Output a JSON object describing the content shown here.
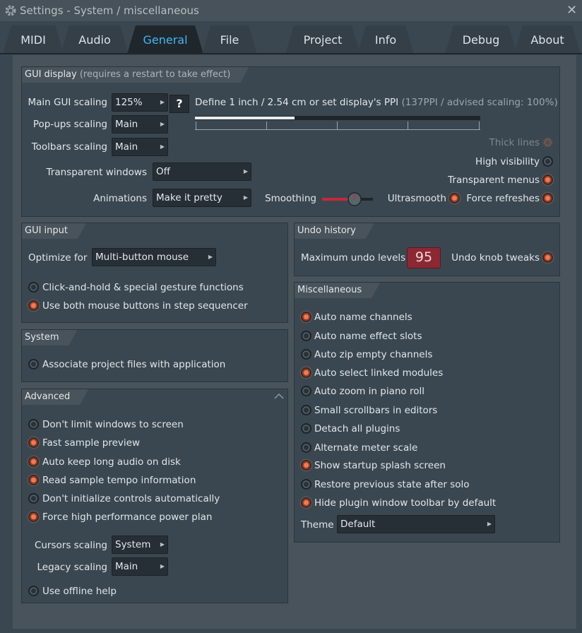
{
  "window": {
    "title": "Settings - System / miscellaneous",
    "close_glyph": "✕"
  },
  "tabs": [
    {
      "label": "MIDI"
    },
    {
      "label": "Audio"
    },
    {
      "label": "General",
      "active": true
    },
    {
      "label": "File"
    },
    {
      "label": "Project"
    },
    {
      "label": "Info"
    },
    {
      "label": "Debug"
    },
    {
      "label": "About"
    }
  ],
  "gui_display": {
    "title": "GUI display",
    "note": "(requires a restart to take effect)",
    "main_gui_scaling": {
      "label": "Main GUI scaling",
      "value": "125%"
    },
    "help_label": "?",
    "ppi_text": "Define 1 inch / 2.54 cm or set display's PPI",
    "ppi_note": "(137PPI / advised scaling: 100%)",
    "ppi_level": 0.35,
    "popups_scaling": {
      "label": "Pop-ups scaling",
      "value": "Main"
    },
    "toolbars_scaling": {
      "label": "Toolbars scaling",
      "value": "Main"
    },
    "transparent_windows": {
      "label": "Transparent windows",
      "value": "Off"
    },
    "animations": {
      "label": "Animations",
      "value": "Make it pretty"
    },
    "smoothing_label": "Smoothing",
    "ultrasmooth": {
      "label": "Ultrasmooth",
      "checked": true
    },
    "thick_lines": {
      "label": "Thick lines",
      "checked": false,
      "disabled": true
    },
    "high_visibility": {
      "label": "High visibility",
      "checked": false
    },
    "transparent_menus": {
      "label": "Transparent menus",
      "checked": true
    },
    "force_refreshes": {
      "label": "Force refreshes",
      "checked": true
    }
  },
  "gui_input": {
    "title": "GUI input",
    "optimize_for": {
      "label": "Optimize for",
      "value": "Multi-button mouse"
    },
    "options": [
      {
        "label": "Click-and-hold & special gesture functions",
        "checked": false
      },
      {
        "label": "Use both mouse buttons in step sequencer",
        "checked": true
      }
    ]
  },
  "system": {
    "title": "System",
    "options": [
      {
        "label": "Associate project files with application",
        "checked": false
      }
    ]
  },
  "advanced": {
    "title": "Advanced",
    "options": [
      {
        "label": "Don't limit windows to screen",
        "checked": false
      },
      {
        "label": "Fast sample preview",
        "checked": true
      },
      {
        "label": "Auto keep long audio on disk",
        "checked": true
      },
      {
        "label": "Read sample tempo information",
        "checked": true
      },
      {
        "label": "Don't initialize controls automatically",
        "checked": false
      },
      {
        "label": "Force high performance power plan",
        "checked": true
      }
    ],
    "cursors_scaling": {
      "label": "Cursors scaling",
      "value": "System"
    },
    "legacy_scaling": {
      "label": "Legacy scaling",
      "value": "Main"
    },
    "offline_help": {
      "label": "Use offline help",
      "checked": false
    }
  },
  "undo_history": {
    "title": "Undo history",
    "max_levels_label": "Maximum undo levels",
    "max_levels_value": "95",
    "knob_tweaks": {
      "label": "Undo knob tweaks",
      "checked": true
    }
  },
  "miscellaneous": {
    "title": "Miscellaneous",
    "options": [
      {
        "label": "Auto name channels",
        "checked": true
      },
      {
        "label": "Auto name effect slots",
        "checked": false
      },
      {
        "label": "Auto zip empty channels",
        "checked": false
      },
      {
        "label": "Auto select linked modules",
        "checked": true
      },
      {
        "label": "Auto zoom in piano roll",
        "checked": false
      },
      {
        "label": "Small scrollbars in editors",
        "checked": false
      },
      {
        "label": "Detach all plugins",
        "checked": false
      },
      {
        "label": "Alternate meter scale",
        "checked": false
      },
      {
        "label": "Show startup splash screen",
        "checked": true
      },
      {
        "label": "Restore previous state after solo",
        "checked": false
      },
      {
        "label": "Hide plugin window toolbar by default",
        "checked": true
      }
    ],
    "theme": {
      "label": "Theme",
      "value": "Default"
    }
  },
  "colors": {
    "accent_active_tab": "#48b4f0",
    "radio_on": "#f07a55",
    "undo_box": "#8c2834"
  }
}
